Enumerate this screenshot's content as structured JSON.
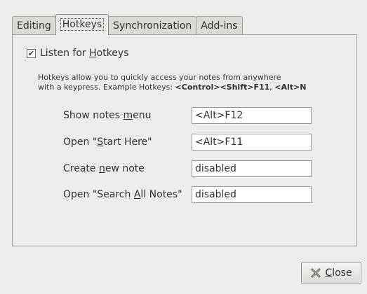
{
  "tabs": [
    "Editing",
    "Hotkeys",
    "Synchronization",
    "Add-ins"
  ],
  "active_tab": "Hotkeys",
  "listen": {
    "checked": true,
    "label_pre": "Listen for ",
    "label_mnemonic": "H",
    "label_post": "otkeys"
  },
  "help": {
    "line1": "Hotkeys allow you to quickly access your notes from anywhere",
    "line2_pre": "with a keypress. Example Hotkeys: ",
    "example1": "<Control><Shift>F11",
    "sep": ", ",
    "example2": "<Alt>N"
  },
  "hotkeys": [
    {
      "label_pre": "Show notes ",
      "mnemonic": "m",
      "label_post": "enu",
      "value": "<Alt>F12"
    },
    {
      "label_pre": "Open \"",
      "mnemonic": "S",
      "label_post": "tart Here\"",
      "value": "<Alt>F11"
    },
    {
      "label_pre": "Create ",
      "mnemonic": "n",
      "label_post": "ew note",
      "value": "disabled"
    },
    {
      "label_pre": "Open \"Search ",
      "mnemonic": "A",
      "label_post": "ll Notes\"",
      "value": "disabled"
    }
  ],
  "close": {
    "mnemonic": "C",
    "label_post": "lose",
    "icon": "close-icon"
  }
}
